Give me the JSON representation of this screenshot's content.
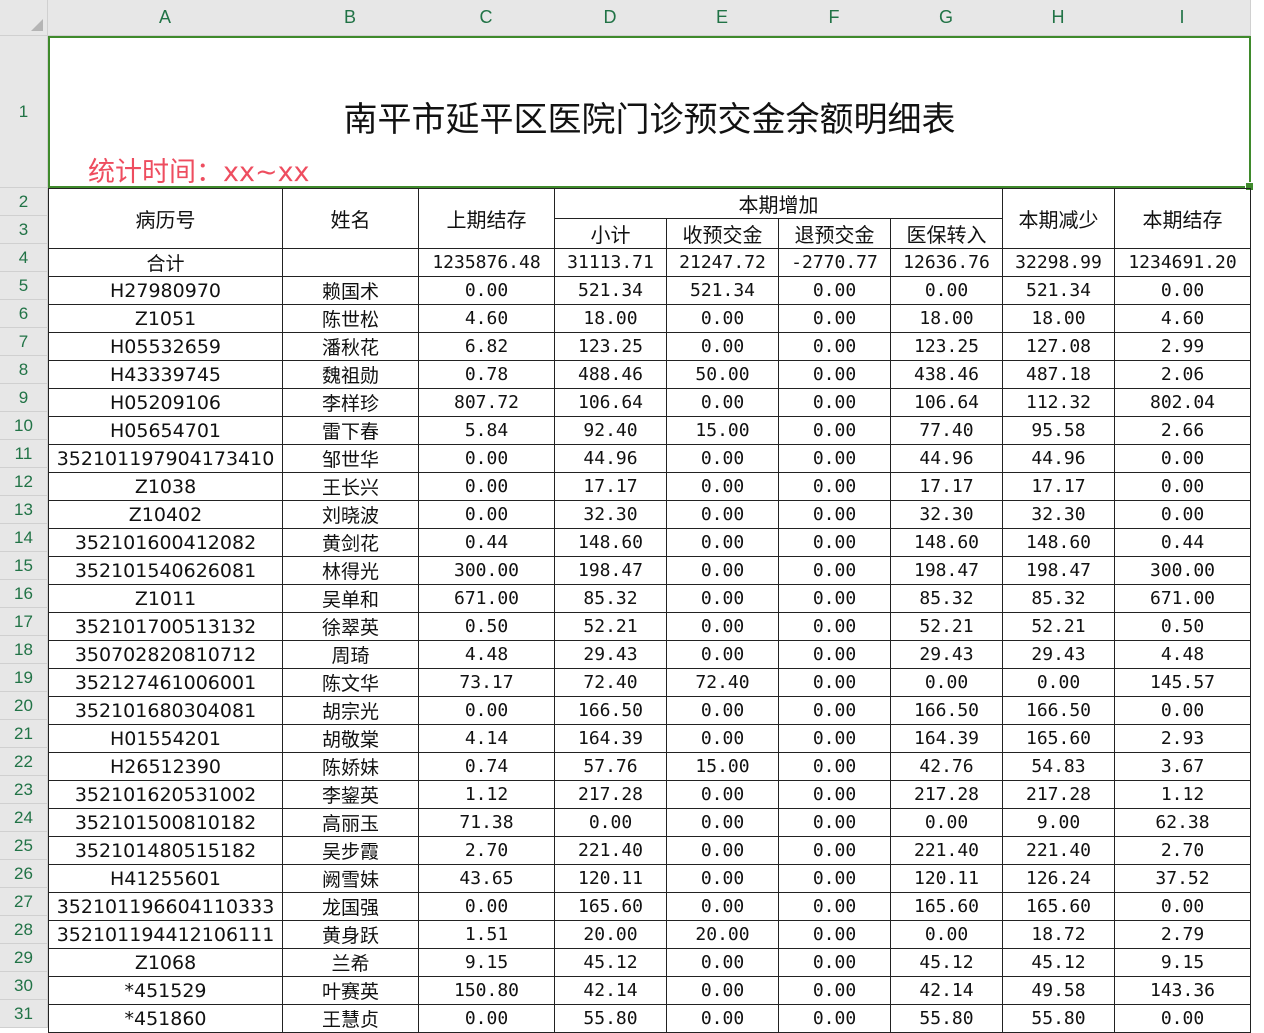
{
  "title": "南平市延平区医院门诊预交金余额明细表",
  "subtitle": "统计时间：xx~xx",
  "columns": [
    "A",
    "B",
    "C",
    "D",
    "E",
    "F",
    "G",
    "H",
    "I"
  ],
  "headers": {
    "record_no": "病历号",
    "name": "姓名",
    "prev_balance": "上期结存",
    "increase": "本期增加",
    "subtotal": "小计",
    "deposit": "收预交金",
    "refund": "退预交金",
    "insurance": "医保转入",
    "decrease": "本期减少",
    "balance": "本期结存"
  },
  "total_row": {
    "label": "合计",
    "name": "",
    "prev": "1235876.48",
    "sub": "31113.71",
    "dep": "21247.72",
    "ref": "-2770.77",
    "ins": "12636.76",
    "dec": "32298.99",
    "bal": "1234691.20"
  },
  "rows": [
    {
      "id": "H27980970",
      "name": "赖国术",
      "prev": "0.00",
      "sub": "521.34",
      "dep": "521.34",
      "ref": "0.00",
      "ins": "0.00",
      "dec": "521.34",
      "bal": "0.00"
    },
    {
      "id": "Z1051",
      "name": "陈世松",
      "prev": "4.60",
      "sub": "18.00",
      "dep": "0.00",
      "ref": "0.00",
      "ins": "18.00",
      "dec": "18.00",
      "bal": "4.60"
    },
    {
      "id": "H05532659",
      "name": "潘秋花",
      "prev": "6.82",
      "sub": "123.25",
      "dep": "0.00",
      "ref": "0.00",
      "ins": "123.25",
      "dec": "127.08",
      "bal": "2.99"
    },
    {
      "id": "H43339745",
      "name": "魏祖勋",
      "prev": "0.78",
      "sub": "488.46",
      "dep": "50.00",
      "ref": "0.00",
      "ins": "438.46",
      "dec": "487.18",
      "bal": "2.06"
    },
    {
      "id": "H05209106",
      "name": "李样珍",
      "prev": "807.72",
      "sub": "106.64",
      "dep": "0.00",
      "ref": "0.00",
      "ins": "106.64",
      "dec": "112.32",
      "bal": "802.04"
    },
    {
      "id": "H05654701",
      "name": "雷下春",
      "prev": "5.84",
      "sub": "92.40",
      "dep": "15.00",
      "ref": "0.00",
      "ins": "77.40",
      "dec": "95.58",
      "bal": "2.66"
    },
    {
      "id": "352101197904173410",
      "name": "邹世华",
      "prev": "0.00",
      "sub": "44.96",
      "dep": "0.00",
      "ref": "0.00",
      "ins": "44.96",
      "dec": "44.96",
      "bal": "0.00"
    },
    {
      "id": "Z1038",
      "name": "王长兴",
      "prev": "0.00",
      "sub": "17.17",
      "dep": "0.00",
      "ref": "0.00",
      "ins": "17.17",
      "dec": "17.17",
      "bal": "0.00"
    },
    {
      "id": "Z10402",
      "name": "刘晓波",
      "prev": "0.00",
      "sub": "32.30",
      "dep": "0.00",
      "ref": "0.00",
      "ins": "32.30",
      "dec": "32.30",
      "bal": "0.00"
    },
    {
      "id": "352101600412082",
      "name": "黄剑花",
      "prev": "0.44",
      "sub": "148.60",
      "dep": "0.00",
      "ref": "0.00",
      "ins": "148.60",
      "dec": "148.60",
      "bal": "0.44"
    },
    {
      "id": "352101540626081",
      "name": "林得光",
      "prev": "300.00",
      "sub": "198.47",
      "dep": "0.00",
      "ref": "0.00",
      "ins": "198.47",
      "dec": "198.47",
      "bal": "300.00"
    },
    {
      "id": "Z1011",
      "name": "吴单和",
      "prev": "671.00",
      "sub": "85.32",
      "dep": "0.00",
      "ref": "0.00",
      "ins": "85.32",
      "dec": "85.32",
      "bal": "671.00"
    },
    {
      "id": "352101700513132",
      "name": "徐翠英",
      "prev": "0.50",
      "sub": "52.21",
      "dep": "0.00",
      "ref": "0.00",
      "ins": "52.21",
      "dec": "52.21",
      "bal": "0.50"
    },
    {
      "id": "350702820810712",
      "name": "周琦",
      "prev": "4.48",
      "sub": "29.43",
      "dep": "0.00",
      "ref": "0.00",
      "ins": "29.43",
      "dec": "29.43",
      "bal": "4.48"
    },
    {
      "id": "352127461006001",
      "name": "陈文华",
      "prev": "73.17",
      "sub": "72.40",
      "dep": "72.40",
      "ref": "0.00",
      "ins": "0.00",
      "dec": "0.00",
      "bal": "145.57"
    },
    {
      "id": "352101680304081",
      "name": "胡宗光",
      "prev": "0.00",
      "sub": "166.50",
      "dep": "0.00",
      "ref": "0.00",
      "ins": "166.50",
      "dec": "166.50",
      "bal": "0.00"
    },
    {
      "id": "H01554201",
      "name": "胡敬棠",
      "prev": "4.14",
      "sub": "164.39",
      "dep": "0.00",
      "ref": "0.00",
      "ins": "164.39",
      "dec": "165.60",
      "bal": "2.93"
    },
    {
      "id": "H26512390",
      "name": "陈娇妹",
      "prev": "0.74",
      "sub": "57.76",
      "dep": "15.00",
      "ref": "0.00",
      "ins": "42.76",
      "dec": "54.83",
      "bal": "3.67"
    },
    {
      "id": "352101620531002",
      "name": "李鋆英",
      "prev": "1.12",
      "sub": "217.28",
      "dep": "0.00",
      "ref": "0.00",
      "ins": "217.28",
      "dec": "217.28",
      "bal": "1.12"
    },
    {
      "id": "352101500810182",
      "name": "高丽玉",
      "prev": "71.38",
      "sub": "0.00",
      "dep": "0.00",
      "ref": "0.00",
      "ins": "0.00",
      "dec": "9.00",
      "bal": "62.38"
    },
    {
      "id": "352101480515182",
      "name": "吴步霞",
      "prev": "2.70",
      "sub": "221.40",
      "dep": "0.00",
      "ref": "0.00",
      "ins": "221.40",
      "dec": "221.40",
      "bal": "2.70"
    },
    {
      "id": "H41255601",
      "name": "阙雪妹",
      "prev": "43.65",
      "sub": "120.11",
      "dep": "0.00",
      "ref": "0.00",
      "ins": "120.11",
      "dec": "126.24",
      "bal": "37.52"
    },
    {
      "id": "352101196604110333",
      "name": "龙国强",
      "prev": "0.00",
      "sub": "165.60",
      "dep": "0.00",
      "ref": "0.00",
      "ins": "165.60",
      "dec": "165.60",
      "bal": "0.00"
    },
    {
      "id": "352101194412106111",
      "name": "黄身跃",
      "prev": "1.51",
      "sub": "20.00",
      "dep": "20.00",
      "ref": "0.00",
      "ins": "0.00",
      "dec": "18.72",
      "bal": "2.79"
    },
    {
      "id": "Z1068",
      "name": "兰希",
      "prev": "9.15",
      "sub": "45.12",
      "dep": "0.00",
      "ref": "0.00",
      "ins": "45.12",
      "dec": "45.12",
      "bal": "9.15"
    },
    {
      "id": "*451529",
      "name": "叶赛英",
      "prev": "150.80",
      "sub": "42.14",
      "dep": "0.00",
      "ref": "0.00",
      "ins": "42.14",
      "dec": "49.58",
      "bal": "143.36"
    },
    {
      "id": "*451860",
      "name": "王慧贞",
      "prev": "0.00",
      "sub": "55.80",
      "dep": "0.00",
      "ref": "0.00",
      "ins": "55.80",
      "dec": "55.80",
      "bal": "0.00"
    }
  ]
}
